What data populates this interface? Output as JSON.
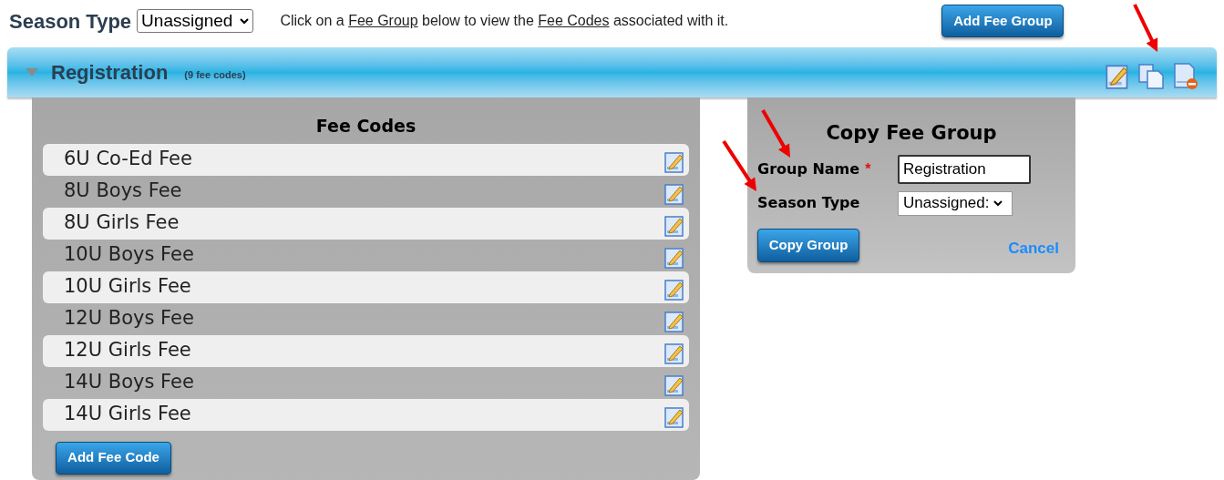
{
  "season_filter": {
    "label": "Season Type",
    "value": "Unassigned"
  },
  "instruction": [
    {
      "kind": "text",
      "text": "Click on a "
    },
    {
      "kind": "link",
      "text": "Fee Group"
    },
    {
      "kind": "text",
      "text": " below to view the "
    },
    {
      "kind": "link",
      "text": "Fee Codes"
    },
    {
      "kind": "text",
      "text": " associated with it."
    }
  ],
  "add_group_button": "Add Fee Group",
  "group": {
    "name": "Registration",
    "count": "(9 fee codes)",
    "expanded": true
  },
  "fee_codes": {
    "title": "Fee Codes",
    "items": [
      "6U Co-Ed Fee",
      "8U Boys Fee",
      "8U Girls Fee",
      "10U Boys Fee",
      "10U Girls Fee",
      "12U Boys Fee",
      "12U Girls Fee",
      "14U Boys Fee",
      "14U Girls Fee"
    ],
    "add_button": "Add Fee Code"
  },
  "copy_panel": {
    "title": "Copy Fee Group",
    "group_name_label": "Group Name",
    "required_mark": "*",
    "group_name_value": "Registration",
    "season_type_label": "Season Type",
    "season_type_value": "Unassigned:",
    "copy_button": "Copy Group",
    "cancel_link": "Cancel"
  }
}
